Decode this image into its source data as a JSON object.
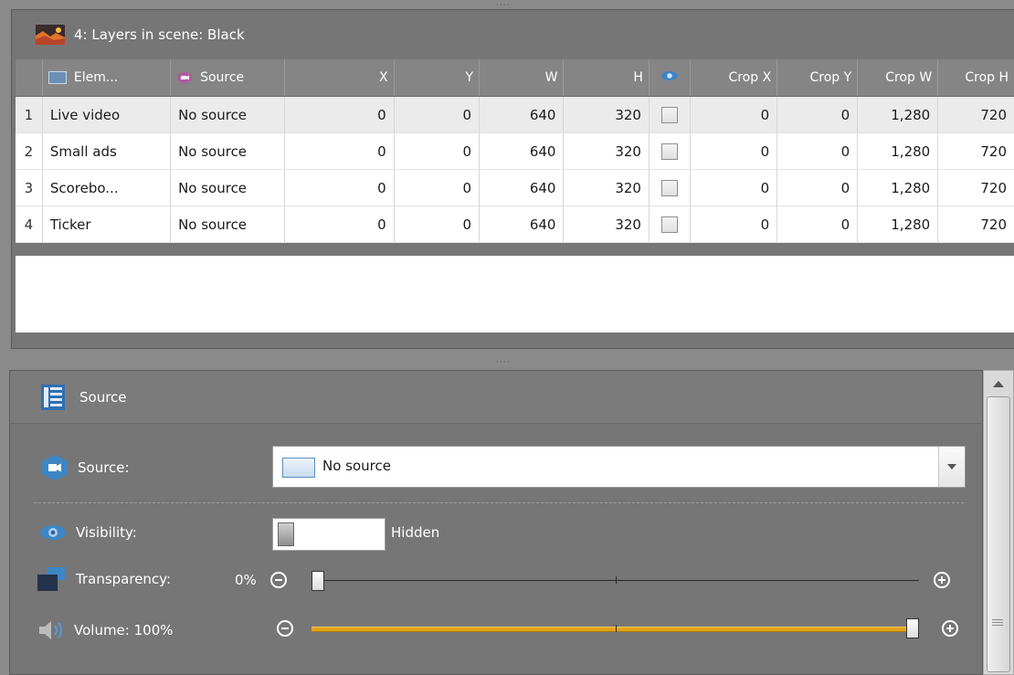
{
  "layers_panel": {
    "title": "4: Layers in scene: Black",
    "columns": {
      "element": "Elem...",
      "source": "Source",
      "x": "X",
      "y": "Y",
      "w": "W",
      "h": "H",
      "crop_x": "Crop X",
      "crop_y": "Crop Y",
      "crop_w": "Crop W",
      "crop_h": "Crop H"
    },
    "rows": [
      {
        "n": "1",
        "element": "Live video",
        "source": "No source",
        "x": "0",
        "y": "0",
        "w": "640",
        "h": "320",
        "visible": false,
        "crop_x": "0",
        "crop_y": "0",
        "crop_w": "1,280",
        "crop_h": "720"
      },
      {
        "n": "2",
        "element": "Small ads",
        "source": "No source",
        "x": "0",
        "y": "0",
        "w": "640",
        "h": "320",
        "visible": false,
        "crop_x": "0",
        "crop_y": "0",
        "crop_w": "1,280",
        "crop_h": "720"
      },
      {
        "n": "3",
        "element": "Scorebo...",
        "source": "No source",
        "x": "0",
        "y": "0",
        "w": "640",
        "h": "320",
        "visible": false,
        "crop_x": "0",
        "crop_y": "0",
        "crop_w": "1,280",
        "crop_h": "720"
      },
      {
        "n": "4",
        "element": "Ticker",
        "source": "No source",
        "x": "0",
        "y": "0",
        "w": "640",
        "h": "320",
        "visible": false,
        "crop_x": "0",
        "crop_y": "0",
        "crop_w": "1,280",
        "crop_h": "720"
      }
    ]
  },
  "source_panel": {
    "title": "Source",
    "source_label": "Source:",
    "source_value": "No source",
    "visibility_label": "Visibility:",
    "visibility_state": "Hidden",
    "transparency_label": "Transparency:",
    "transparency_value": "0%",
    "transparency_level": 0,
    "volume_label": "Volume: 100%",
    "volume_level": 1.0
  },
  "colors": {
    "panel_bg": "#767676",
    "volume_track": "#e0a41a",
    "accent_blue": "#5a8cc0"
  }
}
